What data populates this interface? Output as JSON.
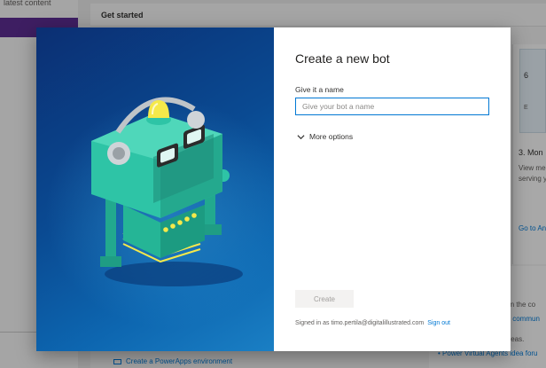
{
  "background": {
    "left_top_text": "latest content",
    "get_started": "Get started",
    "card_title": "3. Mon",
    "card_desc_line1": "View me",
    "card_desc_line2": "serving y",
    "card_link": "Go to An",
    "community_text": "om the co",
    "community_link": "s commun",
    "ideas_text": "ideas.",
    "ideas_link": "Power Virtual Agents idea foru",
    "create_env_link": "Create a PowerApps environment"
  },
  "dialog": {
    "title": "Create a new bot",
    "name_label": "Give it a name",
    "name_placeholder": "Give your bot a name",
    "name_value": "",
    "more_options_label": "More options",
    "create_label": "Create",
    "signed_in_text": "Signed in as timo.pertila@digitalillustrated.com",
    "sign_out_label": "Sign out"
  },
  "colors": {
    "accent": "#0078d4",
    "art_background": "#0a4a92",
    "robot_body": "#2ec4a6",
    "robot_light": "#f5e94a"
  },
  "icons": {
    "more_options": "chevron-down-icon",
    "video": "video-icon"
  }
}
